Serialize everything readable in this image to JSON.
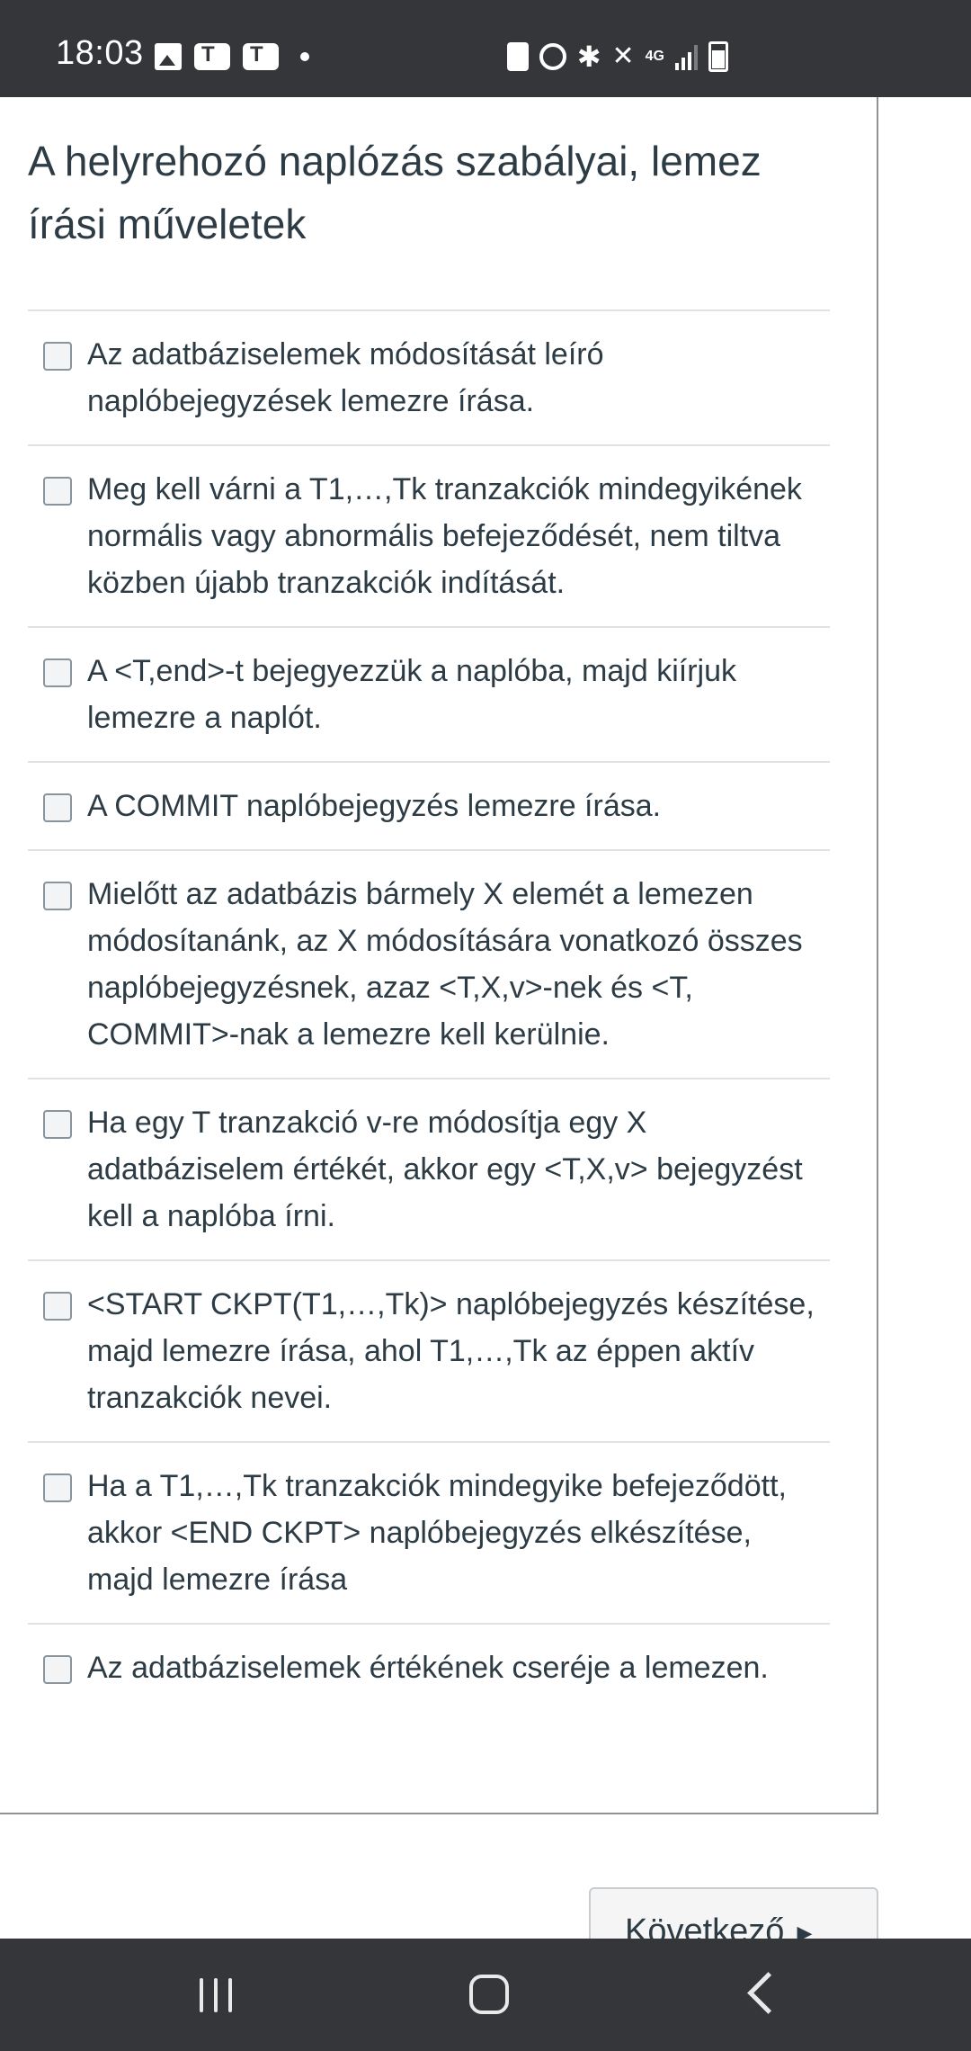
{
  "status_bar": {
    "time": "18:03",
    "network_label": "4G",
    "left_icons": [
      "photo-icon",
      "teams-icon",
      "teams-icon",
      "notification-dot-icon"
    ],
    "right_icons": [
      "battery-saver-icon",
      "alarm-icon",
      "bluetooth-icon",
      "mute-icon",
      "network-4g-icon",
      "signal-icon",
      "battery-icon"
    ]
  },
  "question": {
    "title": "A helyrehozó naplózás szabályai, lemez írási műveletek",
    "answers": [
      {
        "label": "Az adatbáziselemek módosítását leíró naplóbejegyzések lemezre írása.",
        "checked": false
      },
      {
        "label": "Meg kell várni a T1,…,Tk tranzakciók mindegyikének normális vagy abnormális befejeződését, nem tiltva közben újabb tranzakciók indítását.",
        "checked": false
      },
      {
        "label": "A <T,end>-t bejegyezzük a naplóba, majd kiírjuk lemezre a naplót.",
        "checked": false
      },
      {
        "label": "A COMMIT naplóbejegyzés lemezre írása.",
        "checked": false
      },
      {
        "label": "Mielőtt az adatbázis bármely X elemét a lemezen módosítanánk, az X módosítására vonatkozó összes naplóbejegyzésnek, azaz <T,X,v>-nek és <T, COMMIT>-nak a lemezre kell kerülnie.",
        "checked": false
      },
      {
        "label": "Ha egy T tranzakció v-re módosítja egy X adatbáziselem értékét, akkor egy <T,X,v> bejegyzést kell a naplóba írni.",
        "checked": false
      },
      {
        "label": "<START CKPT(T1,…,Tk)> naplóbejegyzés készítése, majd lemezre írása, ahol T1,…,Tk az éppen aktív tranzakciók nevei.",
        "checked": false
      },
      {
        "label": "Ha a T1,…,Tk tranzakciók mindegyike befejeződött, akkor <END CKPT> naplóbejegyzés elkészítése, majd lemezre írása",
        "checked": false
      },
      {
        "label": "Az adatbáziselemek értékének cseréje a lemezen.",
        "checked": false
      }
    ]
  },
  "next_button": {
    "label": "Következő",
    "icon": "caret-right-icon"
  },
  "nav_bar": {
    "icons": [
      "recents-icon",
      "home-icon",
      "back-icon"
    ]
  }
}
